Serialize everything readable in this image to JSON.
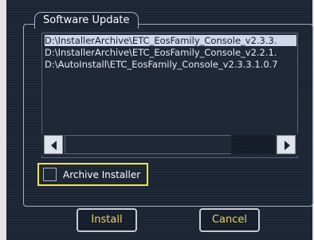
{
  "group": {
    "title": "Software Update"
  },
  "list": {
    "items": [
      {
        "label": "D:\\InstallerArchive\\ETC_EosFamily_Console_v2.3.3.",
        "selected": true
      },
      {
        "label": "D:\\InstallerArchive\\ETC_EosFamily_Console_v2.2.1.",
        "selected": false
      },
      {
        "label": "D:\\AutoInstall\\ETC_EosFamily_Console_v2.3.3.1.0.7",
        "selected": false
      }
    ]
  },
  "checkbox": {
    "label": "Archive Installer",
    "checked": false
  },
  "buttons": {
    "install": "Install",
    "cancel": "Cancel"
  },
  "colors": {
    "panel": "#1b2433",
    "button_text": "#f1d35f",
    "highlight_border": "#f0e633",
    "selection": "#cfd8ea"
  }
}
